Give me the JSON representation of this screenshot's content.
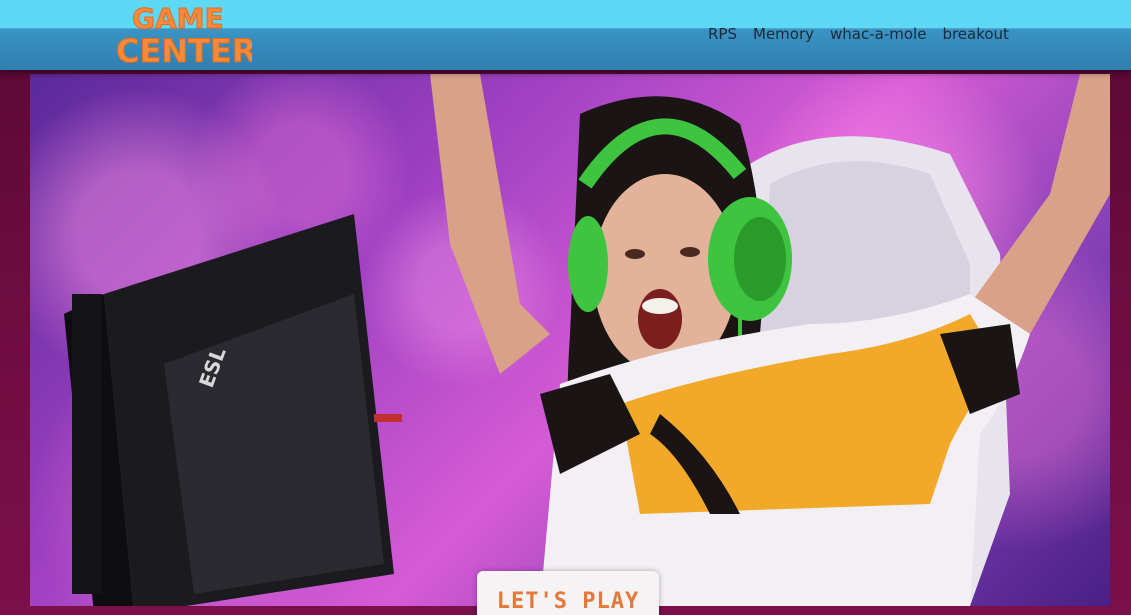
{
  "header": {
    "logo_line1": "GAME",
    "logo_line2": "CENTER."
  },
  "nav": {
    "items": [
      {
        "label": "RPS"
      },
      {
        "label": "Memory"
      },
      {
        "label": "whac-a-mole"
      },
      {
        "label": "breakout"
      }
    ]
  },
  "hero": {
    "monitor_brand": "ESL",
    "cta_label": "LET'S PLAY"
  },
  "colors": {
    "header_top": "#5fd8f5",
    "header_bottom": "#2f7fb0",
    "logo_orange": "#f58a3c",
    "cta_text": "#e4793a",
    "page_bg": "#6e0c42"
  }
}
